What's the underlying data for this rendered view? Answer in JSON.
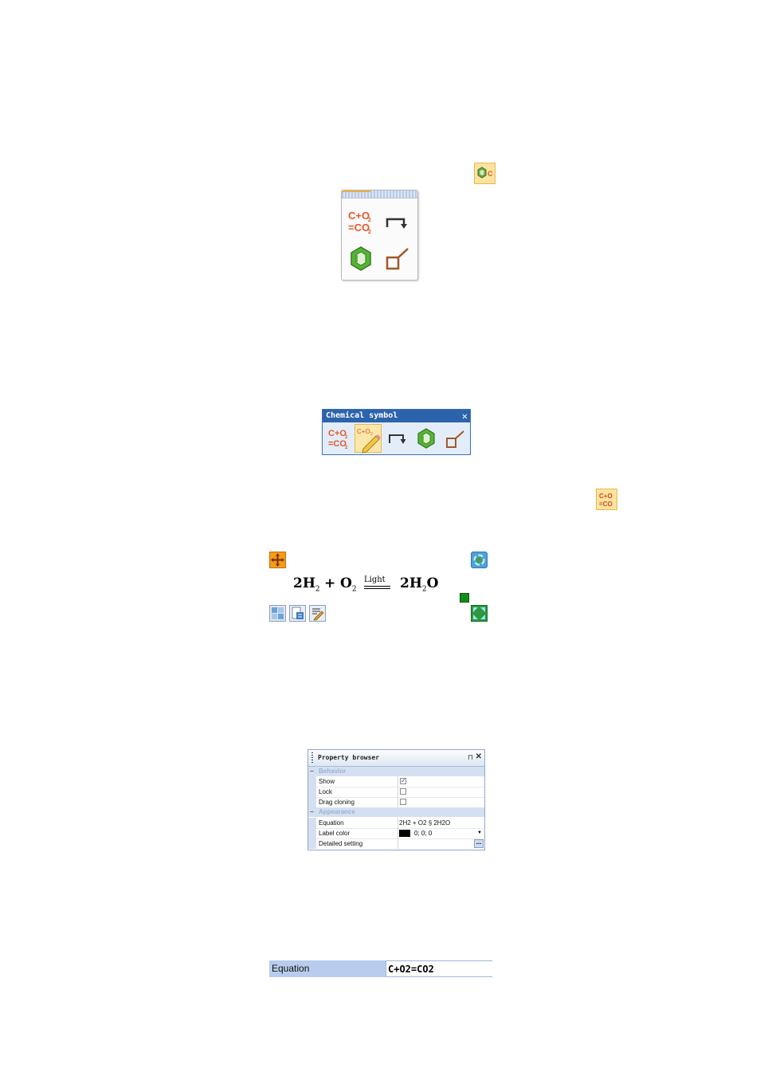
{
  "palette": {
    "tools": [
      {
        "name": "equation",
        "line1": "C+O",
        "sub1": "2",
        "line2": "=CO",
        "sub2": "2"
      },
      {
        "name": "arrow"
      },
      {
        "name": "hexagon"
      },
      {
        "name": "bond"
      }
    ]
  },
  "toolbar": {
    "title": "Chemical symbol",
    "close": "✕",
    "tools": [
      {
        "name": "equation",
        "line1": "C+O",
        "sub1": "2",
        "line2": "=CO",
        "sub2": "2"
      },
      {
        "name": "edit-equation",
        "text": "C+O",
        "sub": "2",
        "active": true
      },
      {
        "name": "arrow"
      },
      {
        "name": "hexagon"
      },
      {
        "name": "bond"
      }
    ]
  },
  "equation": {
    "c1": "2H",
    "s1": "2",
    "plus": "+",
    "c2": "O",
    "s2": "2",
    "condition": "Light",
    "c3": "2H",
    "s3": "2",
    "c3b": "O"
  },
  "property_browser": {
    "title": "Property browser",
    "pin": "⊓",
    "close": "✕",
    "categories": [
      {
        "sign": "−",
        "label": "Behavior"
      },
      {
        "sign": "−",
        "label": "Appearance"
      }
    ],
    "behavior_rows": [
      {
        "name": "Show",
        "checked": true
      },
      {
        "name": "Lock",
        "checked": false
      },
      {
        "name": "Drag cloning",
        "checked": false
      }
    ],
    "appearance_rows": {
      "equation": {
        "name": "Equation",
        "value": "2H2 + O2 § 2H2O"
      },
      "label_color": {
        "name": "Label color",
        "value": "0; 0; 0",
        "color": "#000000"
      },
      "detailed": {
        "name": "Detailed setting",
        "button": "..."
      }
    }
  },
  "edit_row": {
    "label": "Equation",
    "value": "C+O2=CO2"
  },
  "colors": {
    "accent_orange": "#e2592a",
    "hex_green": "#59b33a",
    "bond_brown": "#a0592a",
    "toolbar_blue": "#2d63ad",
    "handle_green": "#138a1c"
  }
}
